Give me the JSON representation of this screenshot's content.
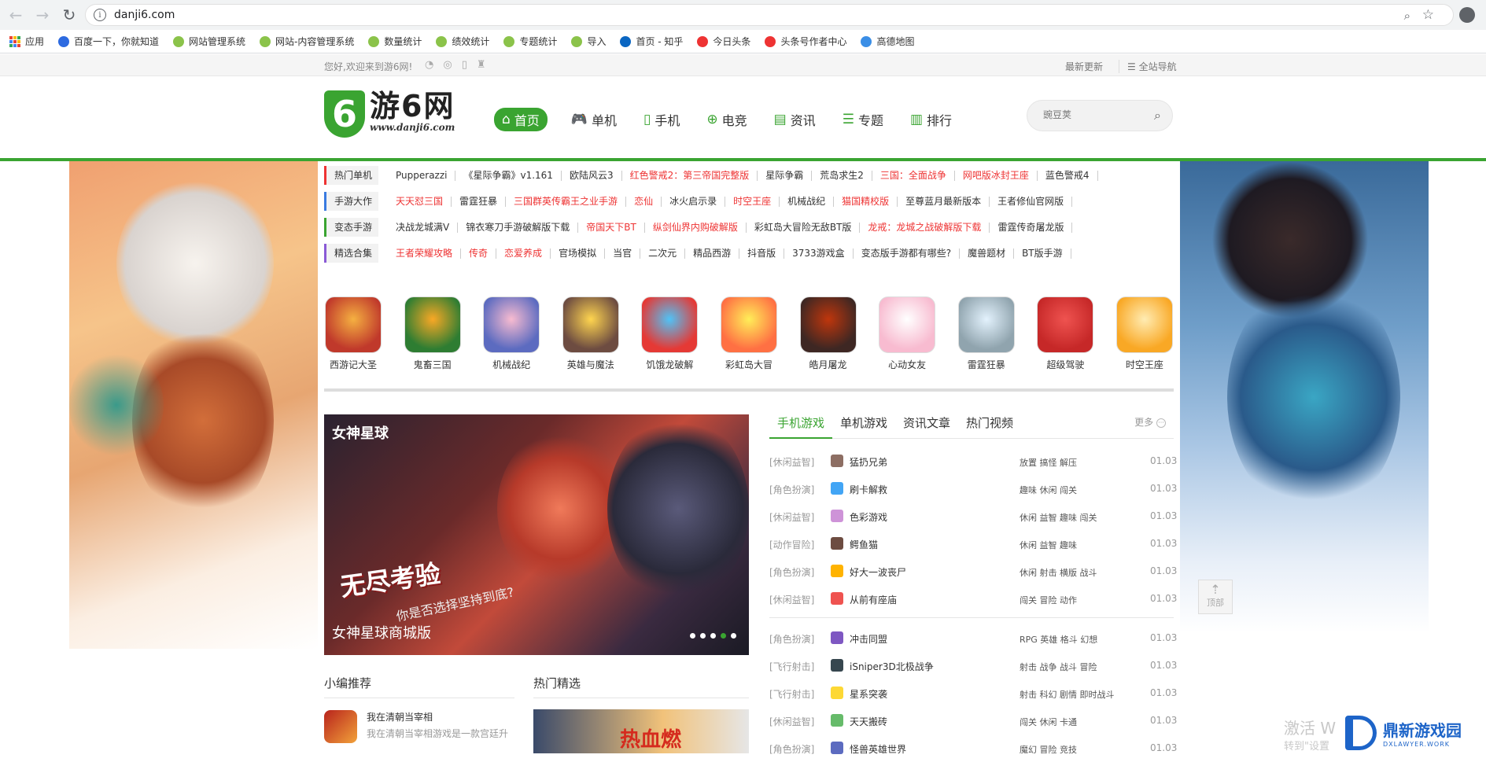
{
  "browser": {
    "url": "danji6.com",
    "bookmarks": [
      {
        "label": "应用",
        "color": "#ea4335"
      },
      {
        "label": "百度一下，你就知道",
        "color": "#2d6ae0"
      },
      {
        "label": "网站管理系统",
        "color": "#8bc34a"
      },
      {
        "label": "网站-内容管理系统",
        "color": "#8bc34a"
      },
      {
        "label": "数量统计",
        "color": "#8bc34a"
      },
      {
        "label": "绩效统计",
        "color": "#8bc34a"
      },
      {
        "label": "专题统计",
        "color": "#8bc34a"
      },
      {
        "label": "导入",
        "color": "#8bc34a"
      },
      {
        "label": "首页 - 知乎",
        "color": "#0a66c2"
      },
      {
        "label": "今日头条",
        "color": "#e33"
      },
      {
        "label": "头条号作者中心",
        "color": "#e33"
      },
      {
        "label": "高德地图",
        "color": "#3a8ee6"
      }
    ]
  },
  "topstrip": {
    "welcome": "您好,欢迎来到游6网!",
    "latest": "最新更新",
    "allnav": "全站导航"
  },
  "header": {
    "logo_mark": "6",
    "logo_cn": "游6网",
    "logo_en": "www.danji6.com",
    "nav": [
      {
        "label": "首页",
        "icon": "home-icon",
        "glyph": "⌂"
      },
      {
        "label": "单机",
        "icon": "gamepad-icon",
        "glyph": "🎮"
      },
      {
        "label": "手机",
        "icon": "phone-icon",
        "glyph": "▯"
      },
      {
        "label": "电竞",
        "icon": "controller-icon",
        "glyph": "⊕"
      },
      {
        "label": "资讯",
        "icon": "news-icon",
        "glyph": "▤"
      },
      {
        "label": "专题",
        "icon": "topic-icon",
        "glyph": "☰"
      },
      {
        "label": "排行",
        "icon": "rank-icon",
        "glyph": "▥"
      }
    ],
    "search_placeholder": "豌豆荚"
  },
  "tag_rows": [
    {
      "head": "热门单机",
      "links": [
        {
          "t": "Pupperazzi",
          "red": false
        },
        {
          "t": "《星际争霸》v1.161",
          "red": false
        },
        {
          "t": "欧陆风云3",
          "red": false
        },
        {
          "t": "红色警戒2：第三帝国完整版",
          "red": true
        },
        {
          "t": "星际争霸",
          "red": false
        },
        {
          "t": "荒岛求生2",
          "red": false
        },
        {
          "t": "三国：全面战争",
          "red": true
        },
        {
          "t": "网吧版冰封王座",
          "red": true
        },
        {
          "t": "蓝色警戒4",
          "red": false
        }
      ]
    },
    {
      "head": "手游大作",
      "links": [
        {
          "t": "天天怼三国",
          "red": true
        },
        {
          "t": "雷霆狂暴",
          "red": false
        },
        {
          "t": "三国群英传霸王之业手游",
          "red": true
        },
        {
          "t": "恋仙",
          "red": true
        },
        {
          "t": "冰火启示录",
          "red": false
        },
        {
          "t": "时空王座",
          "red": true
        },
        {
          "t": "机械战纪",
          "red": false
        },
        {
          "t": "猫国精校版",
          "red": true
        },
        {
          "t": "至尊蓝月最新版本",
          "red": false
        },
        {
          "t": "王者修仙官网版",
          "red": false
        }
      ]
    },
    {
      "head": "变态手游",
      "links": [
        {
          "t": "决战龙城满V",
          "red": false
        },
        {
          "t": "锦衣寒刀手游破解版下载",
          "red": false
        },
        {
          "t": "帝国天下BT",
          "red": true
        },
        {
          "t": "纵剑仙界内购破解版",
          "red": true
        },
        {
          "t": "彩虹岛大冒险无敌BT版",
          "red": false
        },
        {
          "t": "龙戒：龙城之战破解版下载",
          "red": true
        },
        {
          "t": "雷霆传奇屠龙版",
          "red": false
        }
      ]
    },
    {
      "head": "精选合集",
      "links": [
        {
          "t": "王者荣耀攻略",
          "red": true
        },
        {
          "t": "传奇",
          "red": true
        },
        {
          "t": "恋爱养成",
          "red": true
        },
        {
          "t": "官场模拟",
          "red": false
        },
        {
          "t": "当官",
          "red": false
        },
        {
          "t": "二次元",
          "red": false
        },
        {
          "t": "精品西游",
          "red": false
        },
        {
          "t": "抖音版",
          "red": false
        },
        {
          "t": "3733游戏盒",
          "red": false
        },
        {
          "t": "变态版手游都有哪些?",
          "red": false
        },
        {
          "t": "魔兽题材",
          "red": false
        },
        {
          "t": "BT版手游",
          "red": false
        }
      ]
    }
  ],
  "game_icons": [
    {
      "name": "西游记大圣",
      "c1": "#c0392b",
      "c2": "#f5b041"
    },
    {
      "name": "鬼畜三国",
      "c1": "#2e7d32",
      "c2": "#f9a825"
    },
    {
      "name": "机械战纪",
      "c1": "#5c6bc0",
      "c2": "#f8bbd0"
    },
    {
      "name": "英雄与魔法",
      "c1": "#6d4c41",
      "c2": "#ffd54f"
    },
    {
      "name": "饥饿龙破解",
      "c1": "#e53935",
      "c2": "#4fc3f7"
    },
    {
      "name": "彩虹岛大冒",
      "c1": "#ff7043",
      "c2": "#ffee58"
    },
    {
      "name": "皓月屠龙",
      "c1": "#3e2723",
      "c2": "#bf360c"
    },
    {
      "name": "心动女友",
      "c1": "#f8bbd0",
      "c2": "#fff"
    },
    {
      "name": "雷霆狂暴",
      "c1": "#90a4ae",
      "c2": "#e3f2fd"
    },
    {
      "name": "超级驾驶",
      "c1": "#c62828",
      "c2": "#ef5350"
    },
    {
      "name": "时空王座",
      "c1": "#f9a825",
      "c2": "#ffecb3"
    }
  ],
  "slider": {
    "brand": "女神星球",
    "big": "无尽考验",
    "sub": "你是否选择坚持到底?",
    "caption": "女神星球商城版",
    "active_dot": 3,
    "dot_count": 5
  },
  "sub_sections": {
    "editor_title": "小编推荐",
    "hot_title": "热门精选",
    "editor_item_title": "我在清朝当宰相",
    "editor_item_desc": "我在清朝当宰相游戏是一款宫廷升",
    "hot_banner_text": "热血燃"
  },
  "tabs": {
    "items": [
      "手机游戏",
      "单机游戏",
      "资讯文章",
      "热门视频"
    ],
    "active": 0,
    "more": "更多"
  },
  "game_list_a": [
    {
      "cat": "[休闲益智]",
      "name": "猛扔兄弟",
      "tags": "放置 搞怪 解压",
      "date": "01.03",
      "color": "#8d6e63"
    },
    {
      "cat": "[角色扮演]",
      "name": "刷卡解救",
      "tags": "趣味 休闲 闯关",
      "date": "01.03",
      "color": "#42a5f5"
    },
    {
      "cat": "[休闲益智]",
      "name": "色彩游戏",
      "tags": "休闲 益智 趣味 闯关",
      "date": "01.03",
      "color": "#ce93d8"
    },
    {
      "cat": "[动作冒险]",
      "name": "鳄鱼猫",
      "tags": "休闲 益智 趣味",
      "date": "01.03",
      "color": "#6d4c41"
    },
    {
      "cat": "[角色扮演]",
      "name": "好大一波丧尸",
      "tags": "休闲 射击 横版 战斗",
      "date": "01.03",
      "color": "#ffb300"
    },
    {
      "cat": "[休闲益智]",
      "name": "从前有座庙",
      "tags": "闯关 冒险 动作",
      "date": "01.03",
      "color": "#ef5350"
    }
  ],
  "game_list_b": [
    {
      "cat": "[角色扮演]",
      "name": "冲击同盟",
      "tags": "RPG 英雄 格斗 幻想",
      "date": "01.03",
      "color": "#7e57c2"
    },
    {
      "cat": "[飞行射击]",
      "name": "iSniper3D北极战争",
      "tags": "射击 战争 战斗 冒险",
      "date": "01.03",
      "color": "#37474f"
    },
    {
      "cat": "[飞行射击]",
      "name": "星系突袭",
      "tags": "射击 科幻 剧情 即时战斗",
      "date": "01.03",
      "color": "#fdd835"
    },
    {
      "cat": "[休闲益智]",
      "name": "天天搬砖",
      "tags": "闯关 休闲 卡通",
      "date": "01.03",
      "color": "#66bb6a"
    },
    {
      "cat": "[角色扮演]",
      "name": "怪兽英雄世界",
      "tags": "魔幻 冒险 竞技",
      "date": "01.03",
      "color": "#5c6bc0"
    }
  ],
  "backtop": "顶部",
  "watermark": {
    "activate": "激活 W",
    "activate_sub": "转到\"设置",
    "site_name": "鼎新游戏园",
    "site_en": "DXLAWYER.WORK"
  }
}
